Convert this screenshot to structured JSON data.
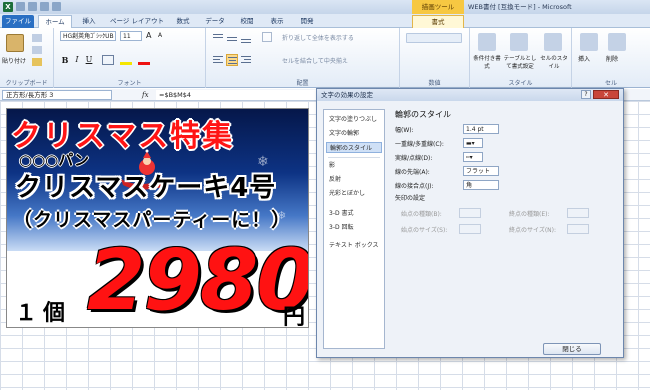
{
  "app": {
    "window_title": "WEB書付 [互換モード] - Microsoft Excel",
    "context_tab_group": "描画ツール",
    "app_icon": "excel-icon"
  },
  "tabs": [
    {
      "label": "ファイル"
    },
    {
      "label": "ホーム"
    },
    {
      "label": "挿入"
    },
    {
      "label": "ページ レイアウト"
    },
    {
      "label": "数式"
    },
    {
      "label": "データ"
    },
    {
      "label": "校閲"
    },
    {
      "label": "表示"
    },
    {
      "label": "開発"
    },
    {
      "label": "書式"
    }
  ],
  "ribbon": {
    "clipboard_label": "クリップボード",
    "paste_label": "貼り付け",
    "font_group_label": "フォント",
    "font_name": "HG創英角ｺﾞｼｯｸUB",
    "font_size": "11",
    "align_group_label": "配置",
    "wrap_text": "折り返して全体を表示する",
    "merge_center": "セルを結合して中央揃え",
    "number_group_label": "数値",
    "styles_group_label": "スタイル",
    "cond_format": "条件付き書式",
    "format_table": "テーブルとして書式設定",
    "cell_styles": "セルのスタイル",
    "cells_group_label": "セル",
    "insert": "挿入",
    "delete": "削除"
  },
  "formula_bar": {
    "name_box": "正方形/長方形 3",
    "fx": "fx",
    "formula": "=$B$M$4"
  },
  "flyer": {
    "title": "クリスマス特集",
    "shop": "○○○パン",
    "product": "クリスマスケーキ4号",
    "note": "（クリスマスパーティーに！）",
    "quantity": "１個",
    "price": "2980",
    "currency": "円"
  },
  "dialog": {
    "title": "文字の効果の設定",
    "nav": [
      "文字の塗りつぶし",
      "文字の輪郭",
      "輪郭のスタイル",
      "影",
      "反射",
      "光彩とぼかし",
      "3-D 書式",
      "3-D 回転",
      "テキスト ボックス"
    ],
    "selected_nav": "輪郭のスタイル",
    "section_title": "輪郭のスタイル",
    "width_label": "幅(W):",
    "width_value": "1.4 pt",
    "compound_label": "一重線/多重線(C):",
    "dash_label": "実線/点線(D):",
    "cap_label": "線の先端(A):",
    "cap_value": "フラット",
    "join_label": "線の接合点(J):",
    "join_value": "角",
    "arrow_section": "矢印の設定",
    "begin_type": "始点の種類(B):",
    "end_type": "終点の種類(E):",
    "begin_size": "始点のサイズ(S):",
    "end_size": "終点のサイズ(N):",
    "close_button": "閉じる"
  }
}
